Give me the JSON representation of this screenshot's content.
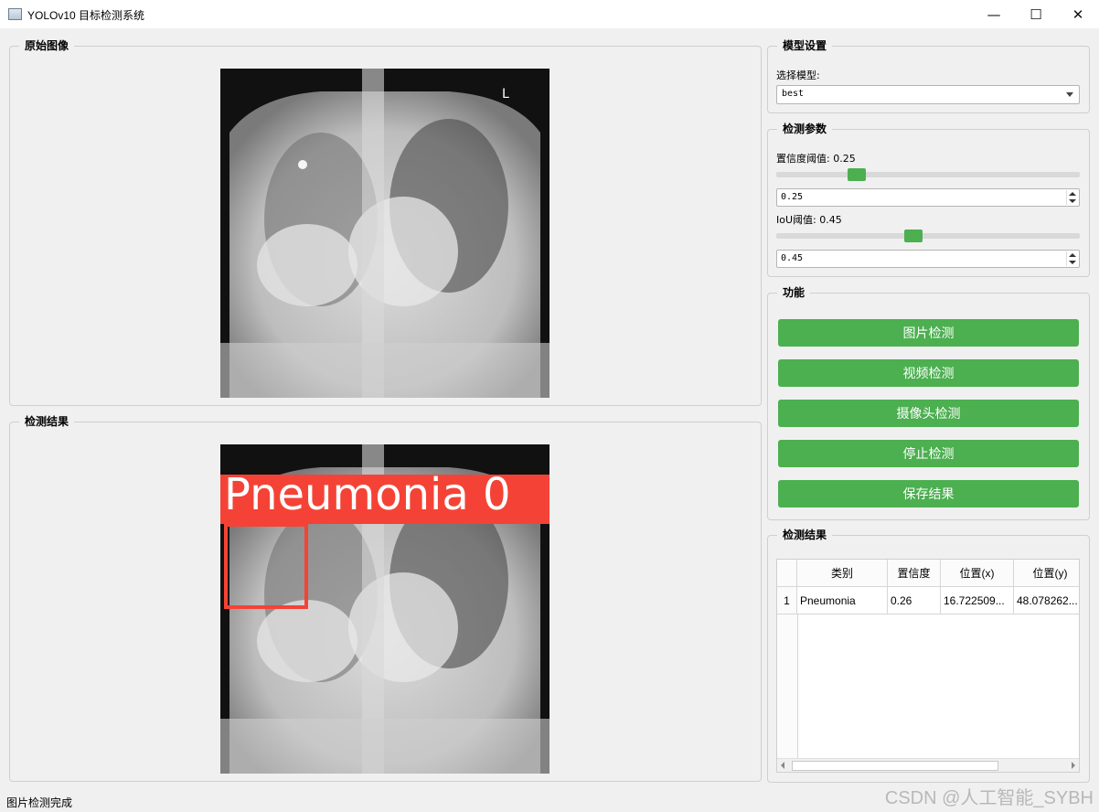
{
  "window": {
    "title": "YOLOv10 目标检测系统",
    "controls": [
      "minimize",
      "maximize",
      "close"
    ]
  },
  "panels": {
    "original": {
      "title": "原始图像"
    },
    "result": {
      "title": "检测结果"
    }
  },
  "model_settings": {
    "title": "模型设置",
    "label": "选择模型:",
    "selected": "best"
  },
  "detection_params": {
    "title": "检测参数",
    "confidence_label": "置信度阈值: 0.25",
    "confidence_value": "0.25",
    "confidence_level": 0.25,
    "iou_label": "IoU阈值: 0.45",
    "iou_value": "0.45",
    "iou_level": 0.45
  },
  "functions": {
    "title": "功能",
    "buttons": [
      "图片检测",
      "视频检测",
      "摄像头检测",
      "停止检测",
      "保存结果"
    ]
  },
  "results": {
    "title": "检测结果",
    "headers": [
      "类别",
      "置信度",
      "位置(x)",
      "位置(y)"
    ],
    "rows": [
      {
        "index": "1",
        "class": "Pneumonia",
        "confidence": "0.26",
        "x": "16.722509...",
        "y": "48.078262..."
      }
    ]
  },
  "detection_overlay": {
    "label": "Pneumonia  0",
    "color": "#f44336"
  },
  "status": "图片检测完成",
  "watermark": "CSDN @人工智能_SYBH",
  "colors": {
    "accent": "#4caf50",
    "detection": "#f44336"
  }
}
